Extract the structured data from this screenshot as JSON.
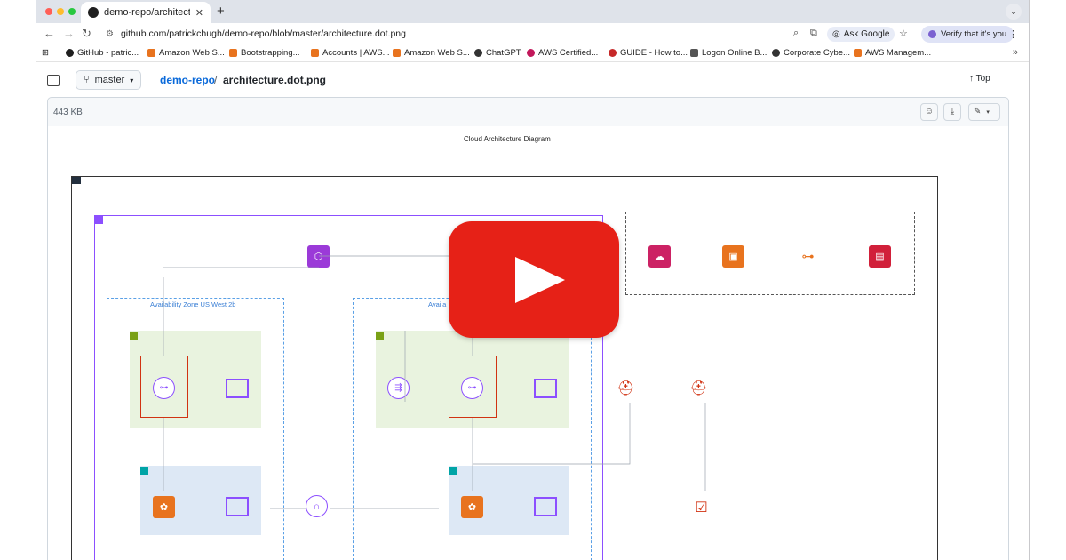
{
  "browser": {
    "tab_title": "demo-repo/architecture.d",
    "new_tab": "+",
    "url": "github.com/patrickchugh/demo-repo/blob/master/architecture.dot.png",
    "ask_google": "Ask Google",
    "verify": "Verify that it's you"
  },
  "bookmarks": [
    {
      "label": "GitHub - patric...",
      "color": "#1f1f1f"
    },
    {
      "label": "Amazon Web S...",
      "color": "#e8731e"
    },
    {
      "label": "Bootstrapping...",
      "color": "#e8731e"
    },
    {
      "label": "Accounts | AWS...",
      "color": "#e8731e"
    },
    {
      "label": "Amazon Web S...",
      "color": "#e8731e"
    },
    {
      "label": "ChatGPT",
      "color": "#333333"
    },
    {
      "label": "AWS Certified...",
      "color": "#c2185b"
    },
    {
      "label": "GUIDE - How to...",
      "color": "#c62828"
    },
    {
      "label": "Logon Online B...",
      "color": "#555555"
    },
    {
      "label": "Corporate Cybe...",
      "color": "#333333"
    },
    {
      "label": "AWS Managem...",
      "color": "#e8731e"
    }
  ],
  "file": {
    "branch": "master",
    "repo": "demo-repo",
    "separator": "/",
    "filename": "architecture.dot.png",
    "top_label": "Top",
    "size": "443 KB"
  },
  "diagram": {
    "title": "Cloud Architecture Diagram",
    "az_left": "Availability Zone US West 2b",
    "az_right": "Availa"
  }
}
